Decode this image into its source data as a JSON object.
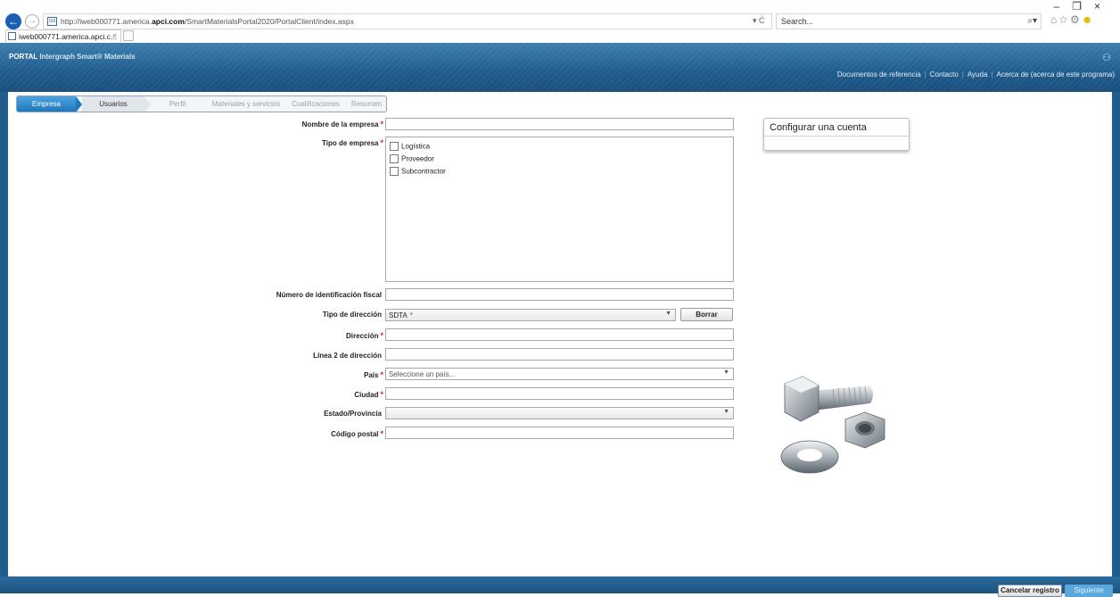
{
  "browser": {
    "url_prefix": "http://iweb000771.america.",
    "url_domain": "apci.com",
    "url_suffix": "/SmartMaterialsPortal2020/PortalClient/index.aspx",
    "address_tools": "▾ Ċ",
    "search_placeholder": "Search...",
    "tab_title": "iweb000771.americа.apci.c...",
    "tab_close": "×"
  },
  "header": {
    "brand_portal": "PORTAL",
    "brand_product": "Intergraph Smart® Materials",
    "links": [
      "Documentos de referencia",
      "Contacto",
      "Ayuda",
      "Acerca de (acerca de este programa)"
    ]
  },
  "wizard": {
    "steps": [
      "Empresa",
      "Usuarios",
      "Perfil",
      "Materiales y servicios",
      "Cualificaciones",
      "Resumen"
    ]
  },
  "form": {
    "company_name_label": "Nombre de la empresa",
    "company_type_label": "Tipo de empresa",
    "company_types": [
      "Logística",
      "Proveedor",
      "Subcontractor"
    ],
    "tax_id_label": "Número de identificación fiscal",
    "address_type_label": "Tipo de dirección",
    "address_type_value": "SDTA",
    "clear_button": "Borrar",
    "address_label": "Dirección",
    "address2_label": "Línea 2 de dirección",
    "country_label": "País",
    "country_placeholder": "Seleccione un país...",
    "city_label": "Ciudad",
    "state_label": "Estado/Provincia",
    "postal_label": "Código postal",
    "required_mark": "*"
  },
  "side_panel": {
    "title": "Configurar una cuenta"
  },
  "footer": {
    "cancel": "Cancelar registro",
    "next": "Siguiente"
  },
  "colors": {
    "header_blue": "#1f5b8c",
    "active_step": "#1f78bd",
    "required": "#d9262c"
  }
}
